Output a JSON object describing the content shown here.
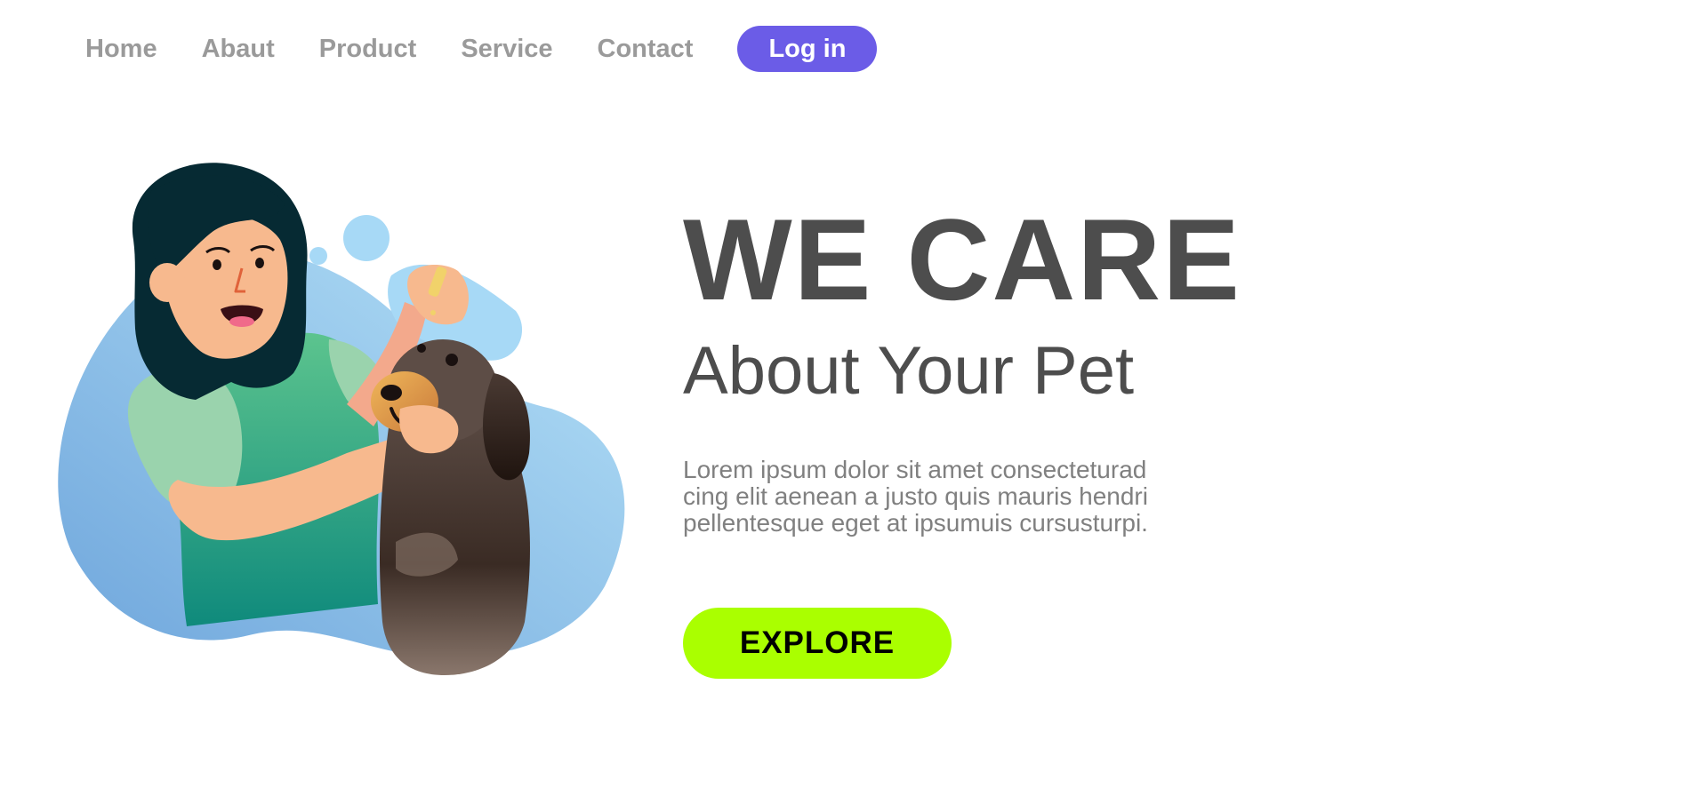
{
  "nav": {
    "items": [
      {
        "label": "Home"
      },
      {
        "label": "Abaut"
      },
      {
        "label": "Product"
      },
      {
        "label": "Service"
      },
      {
        "label": "Contact"
      }
    ],
    "login_label": "Log in"
  },
  "hero": {
    "title": "WE CARE",
    "subtitle": "About Your Pet",
    "body_lines": [
      "Lorem ipsum dolor sit amet consecteturad",
      "cing elit aenean a justo quis mauris hendri",
      "pellentesque eget at ipsumuis cursusturpi."
    ],
    "cta_label": "EXPLORE"
  },
  "illustration": {
    "description_icon": "woman-caring-for-dog-illustration"
  },
  "colors": {
    "accent_purple": "#6b5ce7",
    "accent_lime": "#aaff00",
    "text_dark": "#4d4d4d",
    "text_muted": "#808080",
    "nav_text": "#9a9a9a",
    "blob_blue": "#8fc5ee"
  }
}
